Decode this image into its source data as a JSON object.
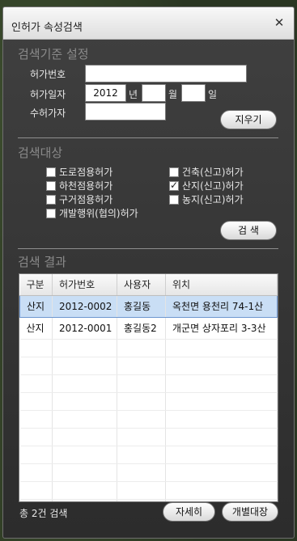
{
  "window": {
    "title": "인허가 속성검색",
    "close_label": "✕"
  },
  "criteria": {
    "heading": "검색기준 설정",
    "permit_no_label": "허가번호",
    "permit_no_value": "",
    "permit_date_label": "허가일자",
    "year_value": "2012",
    "year_unit": "년",
    "month_value": "",
    "month_unit": "월",
    "day_value": "",
    "day_unit": "일",
    "grantee_label": "수허가자",
    "grantee_value": "",
    "clear_button": "지우기"
  },
  "targets": {
    "heading": "검색대상",
    "options": [
      {
        "label": "도로점용허가",
        "checked": false
      },
      {
        "label": "하천점용허가",
        "checked": false
      },
      {
        "label": "구거점용허가",
        "checked": false
      },
      {
        "label": "개발행위(협의)허가",
        "checked": false
      },
      {
        "label": "건축(신고)허가",
        "checked": false
      },
      {
        "label": "산지(신고)허가",
        "checked": true
      },
      {
        "label": "농지(신고)허가",
        "checked": false
      }
    ],
    "search_button": "검 색"
  },
  "results": {
    "heading": "검색 결과",
    "columns": [
      "구분",
      "허가번호",
      "사용자",
      "위치"
    ],
    "rows": [
      [
        "산지",
        "2012-0002",
        "홍길동",
        "옥천면 용천리 74-1산"
      ],
      [
        "산지",
        "2012-0001",
        "홍길동2",
        "개군면 상자포리 3-3산"
      ]
    ],
    "selected_row": 0,
    "count_text": "총 2건 검색",
    "detail_button": "자세히",
    "ledger_button": "개별대장"
  }
}
